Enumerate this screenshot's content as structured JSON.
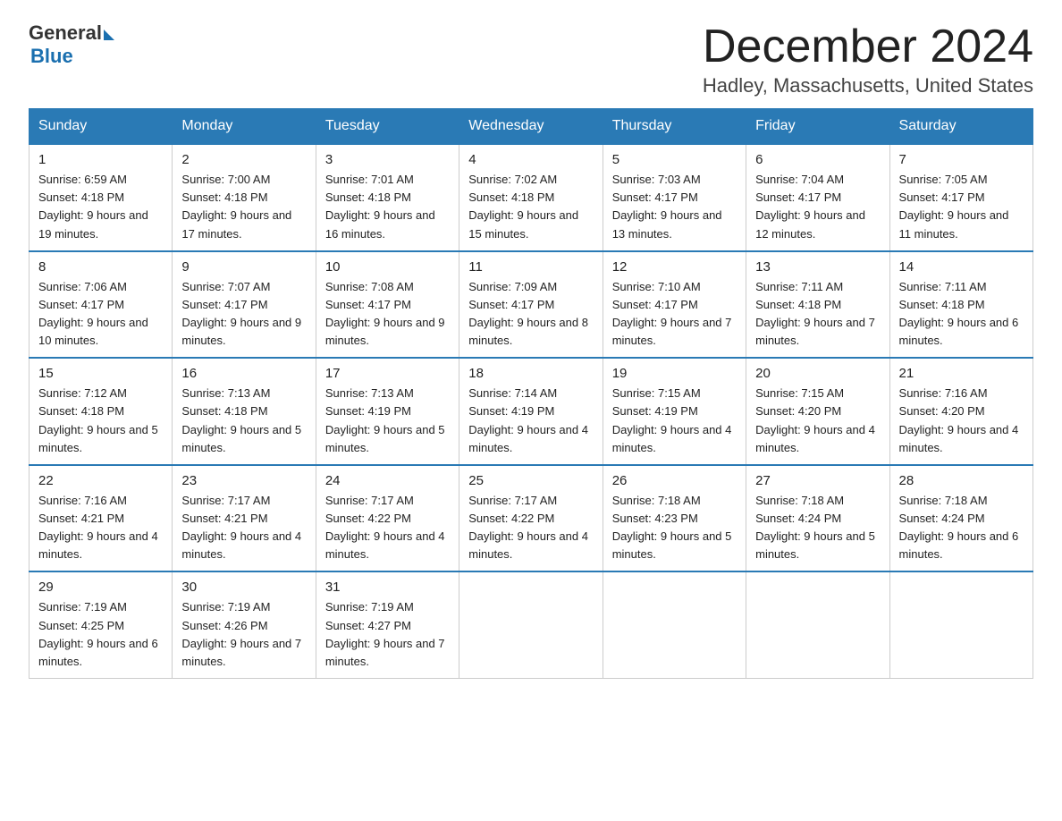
{
  "header": {
    "logo_general": "General",
    "logo_blue": "Blue",
    "title": "December 2024",
    "location": "Hadley, Massachusetts, United States"
  },
  "weekdays": [
    "Sunday",
    "Monday",
    "Tuesday",
    "Wednesday",
    "Thursday",
    "Friday",
    "Saturday"
  ],
  "weeks": [
    [
      {
        "day": "1",
        "sunrise": "Sunrise: 6:59 AM",
        "sunset": "Sunset: 4:18 PM",
        "daylight": "Daylight: 9 hours and 19 minutes."
      },
      {
        "day": "2",
        "sunrise": "Sunrise: 7:00 AM",
        "sunset": "Sunset: 4:18 PM",
        "daylight": "Daylight: 9 hours and 17 minutes."
      },
      {
        "day": "3",
        "sunrise": "Sunrise: 7:01 AM",
        "sunset": "Sunset: 4:18 PM",
        "daylight": "Daylight: 9 hours and 16 minutes."
      },
      {
        "day": "4",
        "sunrise": "Sunrise: 7:02 AM",
        "sunset": "Sunset: 4:18 PM",
        "daylight": "Daylight: 9 hours and 15 minutes."
      },
      {
        "day": "5",
        "sunrise": "Sunrise: 7:03 AM",
        "sunset": "Sunset: 4:17 PM",
        "daylight": "Daylight: 9 hours and 13 minutes."
      },
      {
        "day": "6",
        "sunrise": "Sunrise: 7:04 AM",
        "sunset": "Sunset: 4:17 PM",
        "daylight": "Daylight: 9 hours and 12 minutes."
      },
      {
        "day": "7",
        "sunrise": "Sunrise: 7:05 AM",
        "sunset": "Sunset: 4:17 PM",
        "daylight": "Daylight: 9 hours and 11 minutes."
      }
    ],
    [
      {
        "day": "8",
        "sunrise": "Sunrise: 7:06 AM",
        "sunset": "Sunset: 4:17 PM",
        "daylight": "Daylight: 9 hours and 10 minutes."
      },
      {
        "day": "9",
        "sunrise": "Sunrise: 7:07 AM",
        "sunset": "Sunset: 4:17 PM",
        "daylight": "Daylight: 9 hours and 9 minutes."
      },
      {
        "day": "10",
        "sunrise": "Sunrise: 7:08 AM",
        "sunset": "Sunset: 4:17 PM",
        "daylight": "Daylight: 9 hours and 9 minutes."
      },
      {
        "day": "11",
        "sunrise": "Sunrise: 7:09 AM",
        "sunset": "Sunset: 4:17 PM",
        "daylight": "Daylight: 9 hours and 8 minutes."
      },
      {
        "day": "12",
        "sunrise": "Sunrise: 7:10 AM",
        "sunset": "Sunset: 4:17 PM",
        "daylight": "Daylight: 9 hours and 7 minutes."
      },
      {
        "day": "13",
        "sunrise": "Sunrise: 7:11 AM",
        "sunset": "Sunset: 4:18 PM",
        "daylight": "Daylight: 9 hours and 7 minutes."
      },
      {
        "day": "14",
        "sunrise": "Sunrise: 7:11 AM",
        "sunset": "Sunset: 4:18 PM",
        "daylight": "Daylight: 9 hours and 6 minutes."
      }
    ],
    [
      {
        "day": "15",
        "sunrise": "Sunrise: 7:12 AM",
        "sunset": "Sunset: 4:18 PM",
        "daylight": "Daylight: 9 hours and 5 minutes."
      },
      {
        "day": "16",
        "sunrise": "Sunrise: 7:13 AM",
        "sunset": "Sunset: 4:18 PM",
        "daylight": "Daylight: 9 hours and 5 minutes."
      },
      {
        "day": "17",
        "sunrise": "Sunrise: 7:13 AM",
        "sunset": "Sunset: 4:19 PM",
        "daylight": "Daylight: 9 hours and 5 minutes."
      },
      {
        "day": "18",
        "sunrise": "Sunrise: 7:14 AM",
        "sunset": "Sunset: 4:19 PM",
        "daylight": "Daylight: 9 hours and 4 minutes."
      },
      {
        "day": "19",
        "sunrise": "Sunrise: 7:15 AM",
        "sunset": "Sunset: 4:19 PM",
        "daylight": "Daylight: 9 hours and 4 minutes."
      },
      {
        "day": "20",
        "sunrise": "Sunrise: 7:15 AM",
        "sunset": "Sunset: 4:20 PM",
        "daylight": "Daylight: 9 hours and 4 minutes."
      },
      {
        "day": "21",
        "sunrise": "Sunrise: 7:16 AM",
        "sunset": "Sunset: 4:20 PM",
        "daylight": "Daylight: 9 hours and 4 minutes."
      }
    ],
    [
      {
        "day": "22",
        "sunrise": "Sunrise: 7:16 AM",
        "sunset": "Sunset: 4:21 PM",
        "daylight": "Daylight: 9 hours and 4 minutes."
      },
      {
        "day": "23",
        "sunrise": "Sunrise: 7:17 AM",
        "sunset": "Sunset: 4:21 PM",
        "daylight": "Daylight: 9 hours and 4 minutes."
      },
      {
        "day": "24",
        "sunrise": "Sunrise: 7:17 AM",
        "sunset": "Sunset: 4:22 PM",
        "daylight": "Daylight: 9 hours and 4 minutes."
      },
      {
        "day": "25",
        "sunrise": "Sunrise: 7:17 AM",
        "sunset": "Sunset: 4:22 PM",
        "daylight": "Daylight: 9 hours and 4 minutes."
      },
      {
        "day": "26",
        "sunrise": "Sunrise: 7:18 AM",
        "sunset": "Sunset: 4:23 PM",
        "daylight": "Daylight: 9 hours and 5 minutes."
      },
      {
        "day": "27",
        "sunrise": "Sunrise: 7:18 AM",
        "sunset": "Sunset: 4:24 PM",
        "daylight": "Daylight: 9 hours and 5 minutes."
      },
      {
        "day": "28",
        "sunrise": "Sunrise: 7:18 AM",
        "sunset": "Sunset: 4:24 PM",
        "daylight": "Daylight: 9 hours and 6 minutes."
      }
    ],
    [
      {
        "day": "29",
        "sunrise": "Sunrise: 7:19 AM",
        "sunset": "Sunset: 4:25 PM",
        "daylight": "Daylight: 9 hours and 6 minutes."
      },
      {
        "day": "30",
        "sunrise": "Sunrise: 7:19 AM",
        "sunset": "Sunset: 4:26 PM",
        "daylight": "Daylight: 9 hours and 7 minutes."
      },
      {
        "day": "31",
        "sunrise": "Sunrise: 7:19 AM",
        "sunset": "Sunset: 4:27 PM",
        "daylight": "Daylight: 9 hours and 7 minutes."
      },
      null,
      null,
      null,
      null
    ]
  ]
}
